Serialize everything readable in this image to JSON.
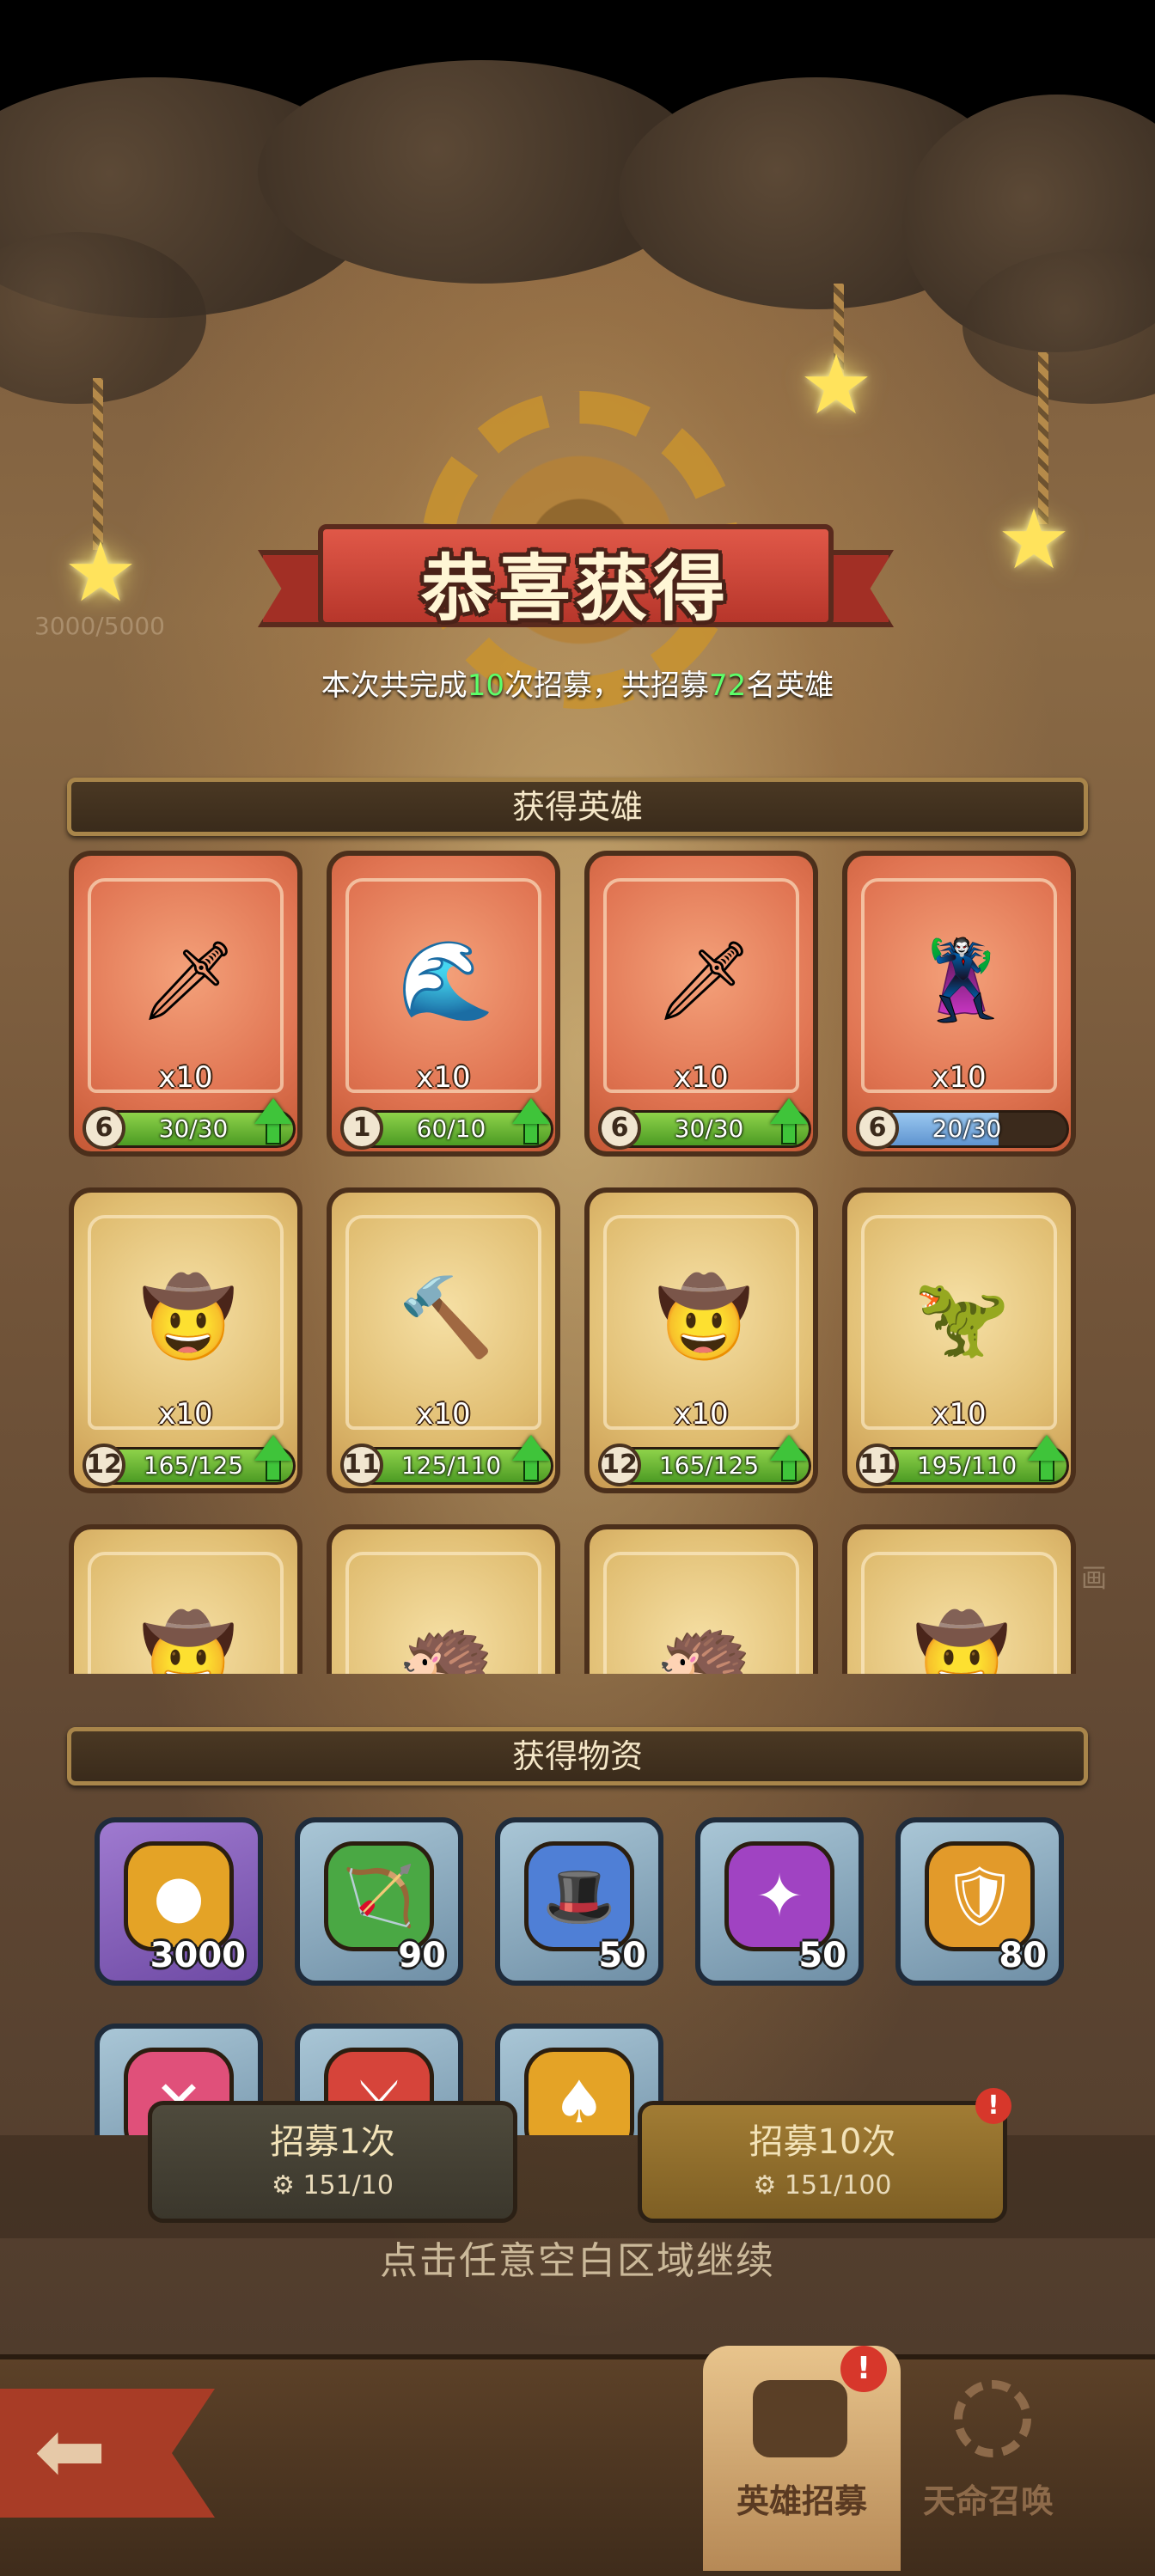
{
  "header": {
    "title": "恭喜获得",
    "subtitle_parts": [
      "本次共完成",
      "10",
      "次招募，共招募",
      "72",
      "名英雄"
    ]
  },
  "heroes_section": {
    "title": "获得英雄",
    "cards": [
      {
        "rarity": "orange",
        "hero": "hooded-swordsman",
        "emoji": "🗡",
        "qty": "x10",
        "level": "6",
        "progress": "30/30",
        "fill": 1.0,
        "upgrade": true
      },
      {
        "rarity": "orange",
        "hero": "water-mage",
        "emoji": "🌊",
        "qty": "x10",
        "level": "1",
        "progress": "60/10",
        "fill": 1.0,
        "upgrade": true
      },
      {
        "rarity": "orange",
        "hero": "hooded-swordsman",
        "emoji": "🗡",
        "qty": "x10",
        "level": "6",
        "progress": "30/30",
        "fill": 1.0,
        "upgrade": true
      },
      {
        "rarity": "orange",
        "hero": "blue-haired-rogue",
        "emoji": "🦹",
        "qty": "x10",
        "level": "6",
        "progress": "20/30",
        "fill": 0.67,
        "upgrade": false
      },
      {
        "rarity": "gold",
        "hero": "cowboy-gunner",
        "emoji": "🤠",
        "qty": "x10",
        "level": "12",
        "progress": "165/125",
        "fill": 1.0,
        "upgrade": true
      },
      {
        "rarity": "gold",
        "hero": "hammer-girl",
        "emoji": "🔨",
        "qty": "x10",
        "level": "11",
        "progress": "125/110",
        "fill": 1.0,
        "upgrade": true
      },
      {
        "rarity": "gold",
        "hero": "cowboy-gunner",
        "emoji": "🤠",
        "qty": "x10",
        "level": "12",
        "progress": "165/125",
        "fill": 1.0,
        "upgrade": true
      },
      {
        "rarity": "gold",
        "hero": "spiked-dino",
        "emoji": "🦖",
        "qty": "x10",
        "level": "11",
        "progress": "195/110",
        "fill": 1.0,
        "upgrade": true
      }
    ],
    "partial_row": [
      "🤠",
      "🦔",
      "🦔",
      "🤠"
    ]
  },
  "items_section": {
    "title": "获得物资",
    "items": [
      {
        "name": "gold-coin",
        "icon": "●",
        "color": "#e4a326",
        "frame": "purple",
        "count": "3000"
      },
      {
        "name": "green-bow-gem",
        "icon": "🏹",
        "color": "#4aa844",
        "frame": "blue",
        "count": "90"
      },
      {
        "name": "blue-wizard-gem",
        "icon": "🎩",
        "color": "#4f7fd6",
        "frame": "blue",
        "count": "50"
      },
      {
        "name": "purple-shuriken-gem",
        "icon": "✦",
        "color": "#a043c2",
        "frame": "blue",
        "count": "50"
      },
      {
        "name": "orange-shield-gem",
        "icon": "🛡",
        "color": "#e29a2a",
        "frame": "blue",
        "count": "80"
      },
      {
        "name": "pink-cross-gem",
        "icon": "✕",
        "color": "#e0507a",
        "frame": "blue",
        "count": ""
      },
      {
        "name": "red-sword-gem",
        "icon": "⚔",
        "color": "#d6443a",
        "frame": "blue",
        "count": ""
      },
      {
        "name": "gold-token",
        "icon": "♠",
        "color": "#e4a326",
        "frame": "blue",
        "count": ""
      }
    ]
  },
  "buttons": {
    "recruit1": {
      "label": "招募1次",
      "cost": "151/10"
    },
    "recruit10": {
      "label": "招募10次",
      "cost": "151/100"
    }
  },
  "hint": "点击任意空白区域继续",
  "background_text": {
    "counter": "3000/5000",
    "side_hint": "画"
  },
  "bottom_nav": {
    "tab_hero": "英雄招募",
    "tab_destiny": "天命召唤"
  }
}
